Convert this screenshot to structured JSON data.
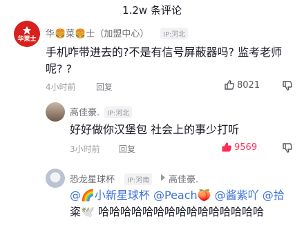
{
  "header": {
    "title": "1.2w 条评论"
  },
  "comments": [
    {
      "author": "华🍔菜🍔士（加盟中心）",
      "ip": "IP:河北",
      "avatar_text": "华莱士",
      "text_line1": "手机咋带进去的?不是有信号屏蔽器吗? 监考老师",
      "text_line2": "呢? ?",
      "time": "4小时前",
      "reply_label": "回复",
      "likes": "8021"
    },
    {
      "author": "高佳豪.",
      "ip": "IP:河北",
      "text": "好好做你汉堡包 社会上的事少打听",
      "time": "3小时前",
      "reply_label": "回复",
      "likes": "9569"
    },
    {
      "author": "恐龙星球杯",
      "ip": "IP:河南",
      "reply_to": "高佳豪.",
      "text_line1": "@🌈小新星球杯 @Peach🍑 @酱紫吖 @拾",
      "text_line2": "粢🕊️ 哈哈哈哈哈哈哈哈哈哈哈哈哈哈哈"
    }
  ],
  "colors": {
    "brand_red": "#d8211d",
    "liked_red": "#fe2c55"
  },
  "icons": [
    "thumb-up-icon",
    "thumb-down-icon",
    "reply-arrow-icon"
  ]
}
